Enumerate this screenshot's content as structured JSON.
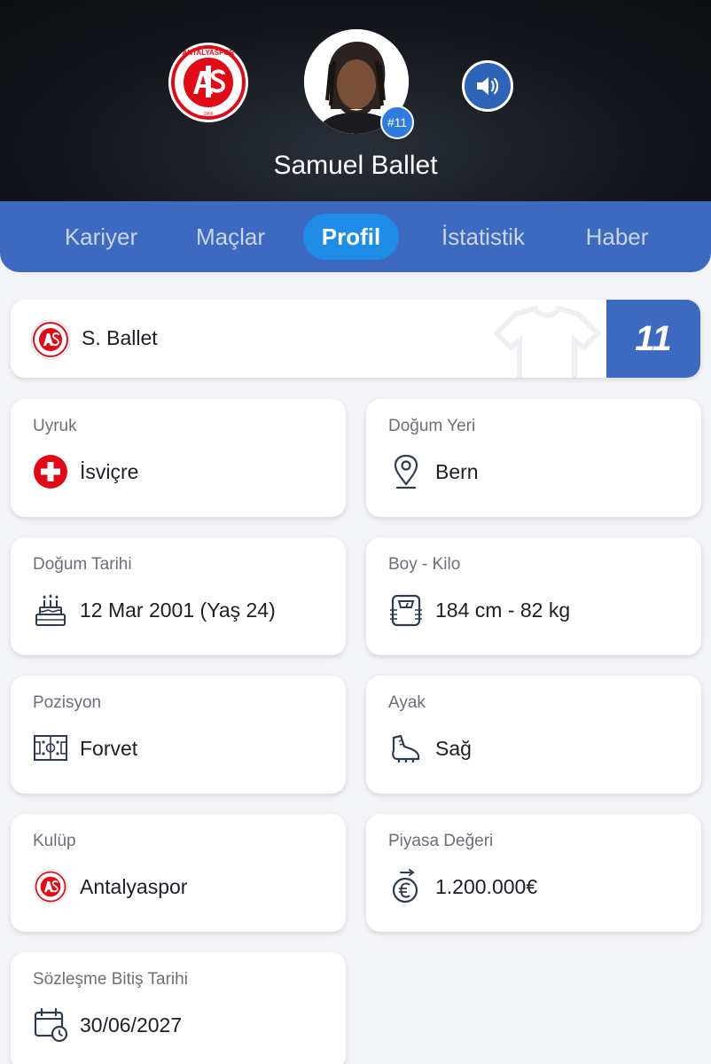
{
  "header": {
    "player_name": "Samuel Ballet",
    "number_badge": "#11",
    "club_logo": {
      "icon": "antalyaspor-logo",
      "text": "ANTALYASPOR",
      "year": "1966"
    },
    "sound_button": {
      "icon": "speaker-icon"
    }
  },
  "tabs": [
    {
      "label": "Kariyer",
      "active": false
    },
    {
      "label": "Maçlar",
      "active": false
    },
    {
      "label": "Profil",
      "active": true
    },
    {
      "label": "İstatistik",
      "active": false
    },
    {
      "label": "Haber",
      "active": false
    }
  ],
  "name_card": {
    "short_name": "S. Ballet",
    "shirt_number": "11"
  },
  "info": {
    "nationality": {
      "label": "Uyruk",
      "value": "İsviçre",
      "icon": "swiss-flag-icon"
    },
    "birthplace": {
      "label": "Doğum Yeri",
      "value": "Bern",
      "icon": "location-pin-icon"
    },
    "birthdate": {
      "label": "Doğum Tarihi",
      "value": "12 Mar 2001 (Yaş 24)",
      "icon": "birthday-cake-icon"
    },
    "height_weight": {
      "label": "Boy - Kilo",
      "value": "184 cm - 82 kg",
      "icon": "scale-icon"
    },
    "position": {
      "label": "Pozisyon",
      "value": "Forvet",
      "icon": "pitch-icon"
    },
    "foot": {
      "label": "Ayak",
      "value": "Sağ",
      "icon": "football-boot-icon"
    },
    "club": {
      "label": "Kulüp",
      "value": "Antalyaspor",
      "icon": "club-logo-icon"
    },
    "market_value": {
      "label": "Piyasa Değeri",
      "value": "1.200.000€",
      "icon": "euro-exchange-icon"
    },
    "contract_end": {
      "label": "Sözleşme Bitiş Tarihi",
      "value": "30/06/2027",
      "icon": "calendar-clock-icon"
    }
  },
  "colors": {
    "primary": "#3d6ac0",
    "active_tab": "#1f8ce8",
    "club_red": "#e30a17",
    "background": "#f3f4f8"
  }
}
